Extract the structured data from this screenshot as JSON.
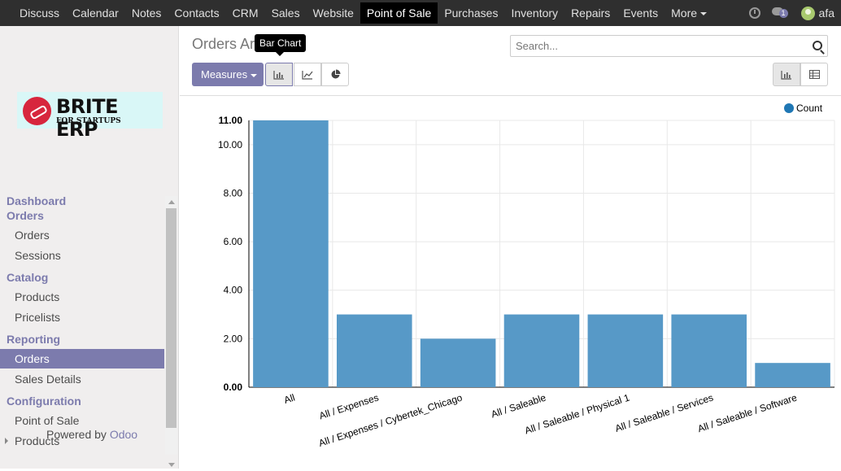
{
  "topbar": {
    "menu": [
      "Discuss",
      "Calendar",
      "Notes",
      "Contacts",
      "CRM",
      "Sales",
      "Website",
      "Point of Sale",
      "Purchases",
      "Inventory",
      "Repairs",
      "Events"
    ],
    "more_label": "More",
    "active_index": 7,
    "messages_badge": "1",
    "user_name": "afa"
  },
  "logo": {
    "brand": "BRITE ERP",
    "tagline": "FOR STARTUPS"
  },
  "sidebar": {
    "dashboard": "Dashboard",
    "orders_section": "Orders",
    "orders_link": "Orders",
    "sessions": "Sessions",
    "catalog": "Catalog",
    "products": "Products",
    "pricelists": "Pricelists",
    "reporting": "Reporting",
    "reporting_orders": "Orders",
    "sales_details": "Sales Details",
    "configuration": "Configuration",
    "point_of_sale": "Point of Sale",
    "config_products": "Products",
    "powered_prefix": "Powered by ",
    "powered_brand": "Odoo"
  },
  "control": {
    "title": "Orders Ar",
    "search_placeholder": "Search...",
    "measures_label": "Measures",
    "tooltip": "Bar Chart"
  },
  "chart_data": {
    "type": "bar",
    "categories": [
      "All",
      "All / Expenses",
      "All / Expenses / Cybertek_Chicago",
      "All / Saleable",
      "All / Saleable / Physical 1",
      "All / Saleable / Services",
      "All / Saleable / Software"
    ],
    "series": [
      {
        "name": "Count",
        "values": [
          11,
          3,
          2,
          3,
          3,
          3,
          1
        ],
        "color": "#5799c7"
      }
    ],
    "yticks": [
      "0.00",
      "2.00",
      "4.00",
      "6.00",
      "8.00",
      "10.00",
      "11.00"
    ],
    "ylim": [
      0,
      11
    ],
    "legend_position": "top-right",
    "grid": true
  }
}
